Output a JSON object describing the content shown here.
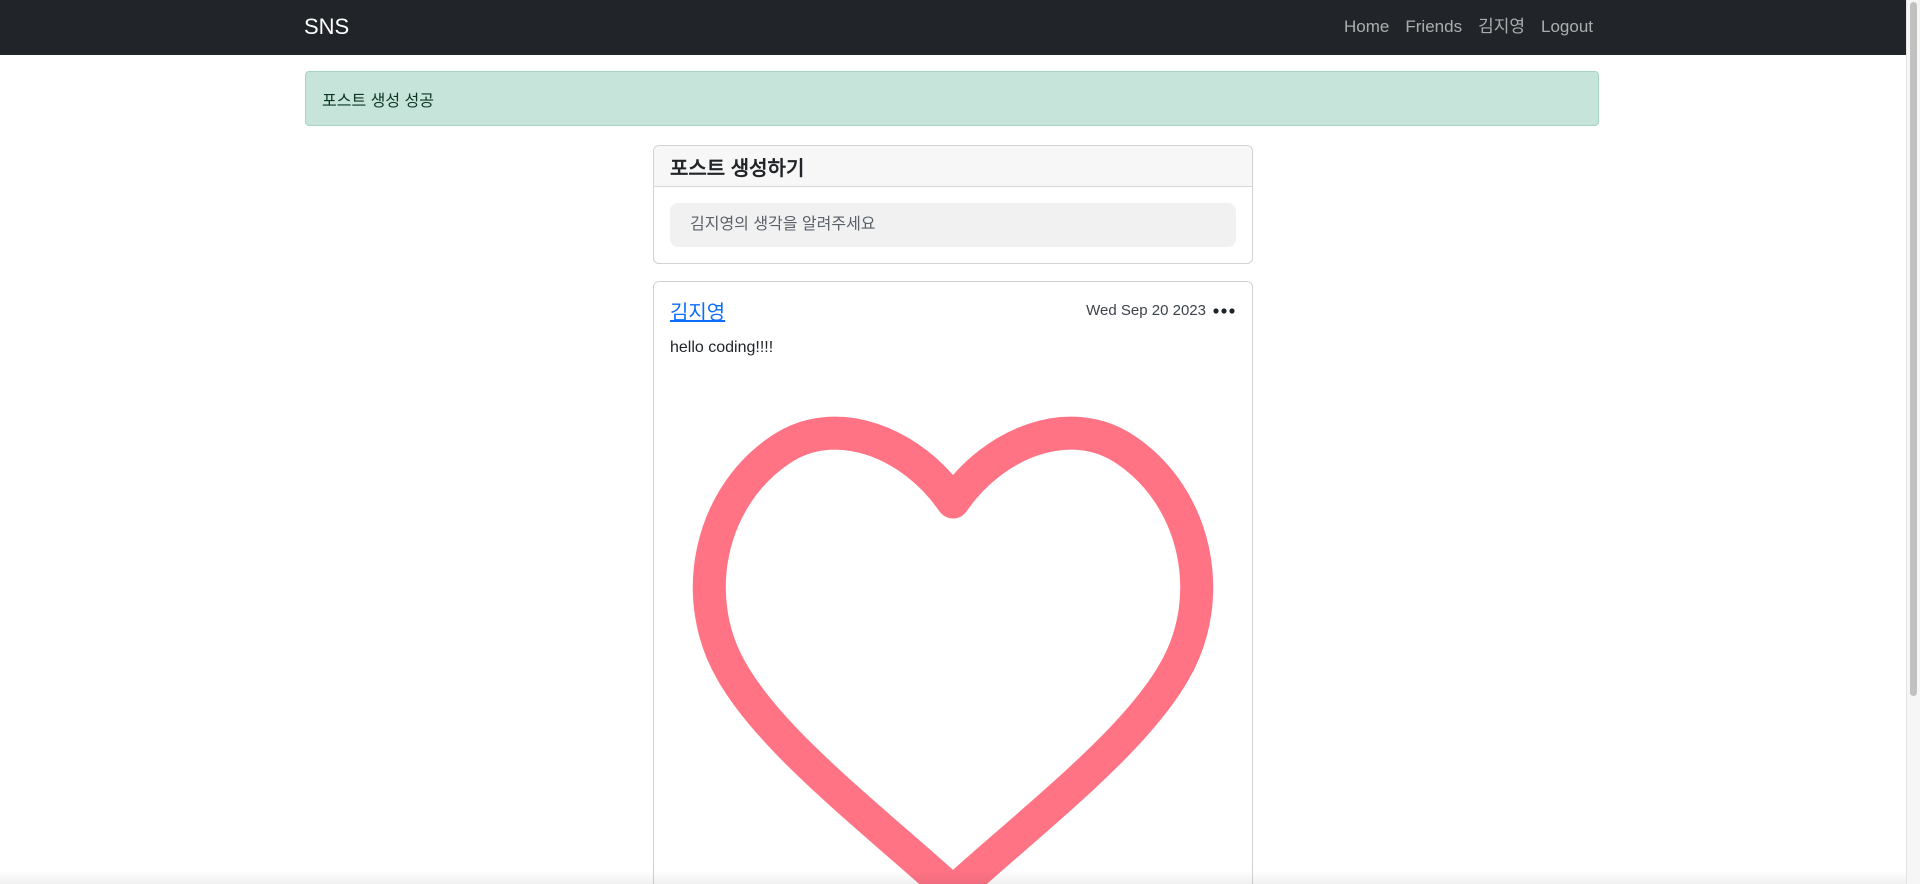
{
  "navbar": {
    "brand": "SNS",
    "links": [
      "Home",
      "Friends",
      "김지영",
      "Logout"
    ]
  },
  "alert": {
    "message": "포스트 생성 성공",
    "color": "#c7e4da"
  },
  "create_post": {
    "title": "포스트 생성하기",
    "placeholder": "김지영의 생각을 알려주세요"
  },
  "post": {
    "author": "김지영",
    "date": "Wed Sep 20 2023",
    "text": "hello coding!!!!",
    "image_icon": "heart-outline-icon",
    "image_color": "#ff7385",
    "menu_icon": "more-horizontal-icon"
  },
  "colors": {
    "navbar_bg": "#212529",
    "link_accent": "#0d6efd"
  }
}
